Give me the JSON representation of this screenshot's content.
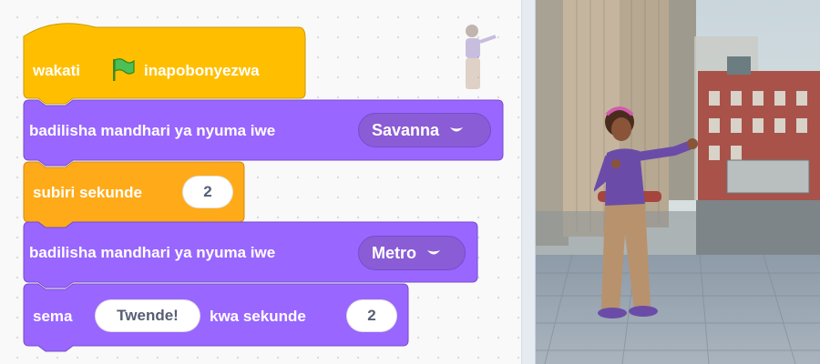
{
  "script": {
    "hat": {
      "prefix": "wakati",
      "suffix": "inapobonyezwa",
      "icon": "green-flag-icon"
    },
    "switch_backdrop_1": {
      "label": "badilisha mandhari ya nyuma iwe",
      "value": "Savanna"
    },
    "wait": {
      "label": "subiri sekunde",
      "seconds": "2"
    },
    "switch_backdrop_2": {
      "label": "badilisha mandhari ya nyuma iwe",
      "value": "Metro"
    },
    "say": {
      "label": "sema",
      "message": "Twende!",
      "middle": "kwa sekunde",
      "seconds": "2"
    }
  },
  "colors": {
    "events": "#ffbf00",
    "looks": "#9966ff",
    "control": "#ffab19"
  },
  "stage": {
    "backdrop": "Metro",
    "sprite": "girl-character"
  }
}
